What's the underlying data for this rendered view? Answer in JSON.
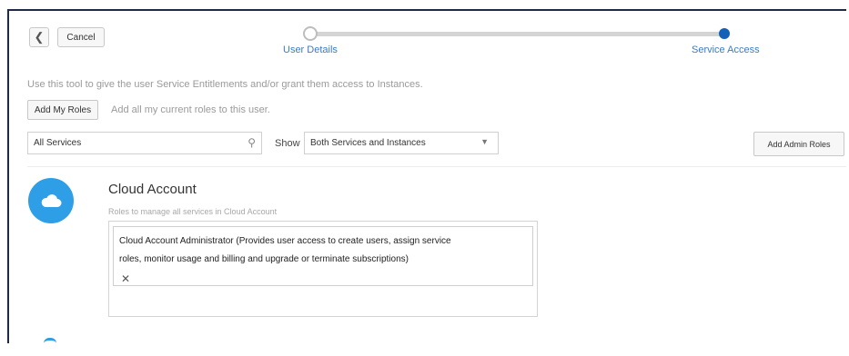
{
  "header": {
    "cancel_label": "Cancel"
  },
  "train": {
    "steps": [
      {
        "label": "User Details"
      },
      {
        "label": "Service Access"
      }
    ]
  },
  "intro_text": "Use this tool to give the user Service Entitlements and/or grant them access to Instances.",
  "add_roles": {
    "button_label": "Add My Roles",
    "hint": "Add all my current roles to this user."
  },
  "filters": {
    "search_value": "All Services",
    "show_label": "Show",
    "show_selected": "Both Services and Instances",
    "admin_roles_label": "Add Admin Roles"
  },
  "service": {
    "title": "Cloud Account",
    "description": "Roles to manage all services in Cloud Account",
    "role_line_1": "Cloud Account Administrator (Provides user access to create users, assign service",
    "role_line_2": "roles, monitor usage and billing and upgrade or terminate subscriptions)"
  },
  "icons": {
    "back": "chevron-left-icon",
    "search": "search-icon",
    "dropdown": "chevron-down-icon",
    "service": "cloud-icon",
    "remove": "close-icon"
  },
  "colors": {
    "accent": "#1561b8",
    "link": "#3b7bc4",
    "service_avatar": "#2e9ee6"
  }
}
